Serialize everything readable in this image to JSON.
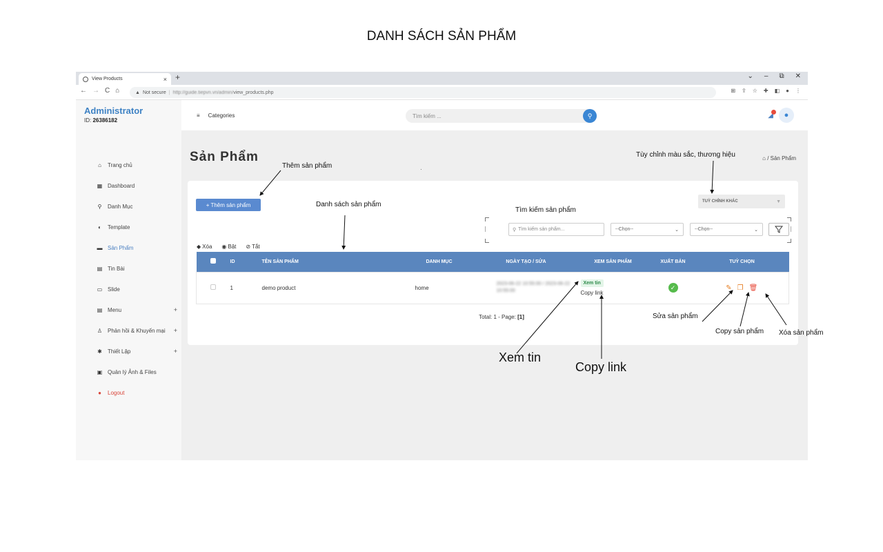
{
  "doc_title": "DANH SÁCH SẢN PHẨM",
  "browser": {
    "tab_title": "View Products",
    "tab_close": "×",
    "new_tab": "+",
    "window_controls": [
      "⌄",
      "–",
      "⧉",
      "✕"
    ],
    "nav": [
      "←",
      "→",
      "C",
      "⌂"
    ],
    "security": "Not secure",
    "url_host": "http://guide.tiepvn.vn/admin/",
    "url_path": "view_products.php"
  },
  "sidebar": {
    "brand": "Administrator",
    "id_label": "ID:",
    "id_value": "26386182",
    "items": [
      {
        "icon": "⌂",
        "label": "Trang chủ"
      },
      {
        "icon": "▦",
        "label": "Dashboard"
      },
      {
        "icon": "⚲",
        "label": "Danh Mục"
      },
      {
        "icon": "◐",
        "label": "Template"
      },
      {
        "icon": "▬",
        "label": "Sản Phẩm"
      },
      {
        "icon": "▤",
        "label": "Tin Bài"
      },
      {
        "icon": "▭",
        "label": "Slide"
      },
      {
        "icon": "▤",
        "label": "Menu",
        "plus": "+"
      },
      {
        "icon": "♙",
        "label": "Phản hồi & Khuyến mại",
        "plus": "+"
      },
      {
        "icon": "✱",
        "label": "Thiết Lập",
        "plus": "+"
      },
      {
        "icon": "▣",
        "label": "Quản lý Ảnh & Files"
      },
      {
        "icon": "●",
        "label": "Logout"
      }
    ]
  },
  "topbar": {
    "hamburger": "≡",
    "categories": "Categories",
    "search_placeholder": "Tìm kiếm ..."
  },
  "page": {
    "title": "Sản Phẩm",
    "breadcrumb": "⌂ / Sản Phẩm",
    "add_button": "+ Thêm sản phẩm",
    "customize": "TUỲ CHỈNH KHÁC",
    "filter_search_placeholder": "Tìm kiếm sản phẩm...",
    "select1": "--Chọn--",
    "select2": "--Chọn--",
    "bulk_delete": "Xóa",
    "bulk_on": "Bật",
    "bulk_off": "Tắt",
    "columns": [
      "ID",
      "TÊN SẢN PHẨM",
      "DANH MỤC",
      "NGÀY TẠO / SỬA",
      "XEM SẢN PHẨM",
      "XUẤT BẢN",
      "TUỲ CHỌN"
    ],
    "rows": [
      {
        "id": "1",
        "name": "demo product",
        "category": "home",
        "date": "2023-06-22 10:55:00 / 2023-06-22 10:55:00",
        "view_tag": "Xem tin",
        "copy_link": "Copy link"
      }
    ],
    "total": "Total: 1 - Page: ",
    "page_num": "[1]"
  },
  "annotations": {
    "add": "Thêm sản phẩm",
    "list": "Danh sách sản phẩm",
    "search": "Tìm kiếm sản phẩm",
    "customize": "Tùy chỉnh màu sắc, thương hiệu",
    "view": "Xem tin",
    "copy_link": "Copy link",
    "edit": "Sửa sản phẩm",
    "copy_product": "Copy sản phẩm",
    "delete": "Xóa sản phẩm"
  },
  "colors": {
    "accent": "#3a86d4",
    "table_header": "#5a86be",
    "publish": "#56bb4c",
    "danger": "#e74c3c"
  }
}
